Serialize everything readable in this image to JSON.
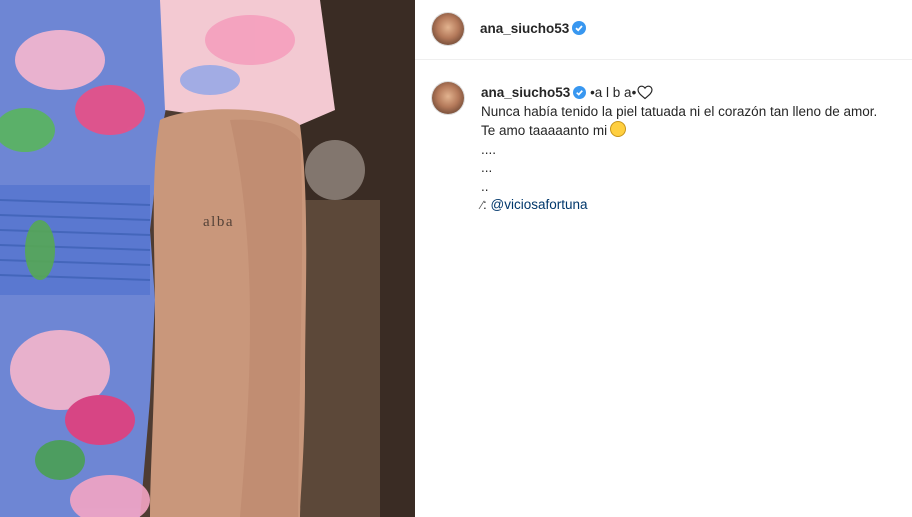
{
  "post": {
    "image_tattoo_text": "alba",
    "image_alt": "alba tattoo on arm"
  },
  "header": {
    "username": "ana_siucho53",
    "avatar_icon": "profile-avatar-icon",
    "verified_icon": "verified-badge-icon"
  },
  "caption": {
    "username": "ana_siucho53",
    "title": "•a l b a•",
    "title_icon": "heart-outline-icon",
    "line1": "Nunca había tenido la piel tatuada ni el corazón tan lleno de amor.",
    "line2": "Te amo taaaaanto mi",
    "line2_icon": "smiling-face-icon",
    "line3": "....",
    "line4": "...",
    "line5": "..",
    "credit_icon": "syringe-icon",
    "credit_prefix": ":",
    "credit_mention": "@viciosafortuna"
  },
  "colors": {
    "verified": "#3897f0",
    "mention": "#00376b",
    "text": "#262626",
    "divider": "#efefef"
  }
}
